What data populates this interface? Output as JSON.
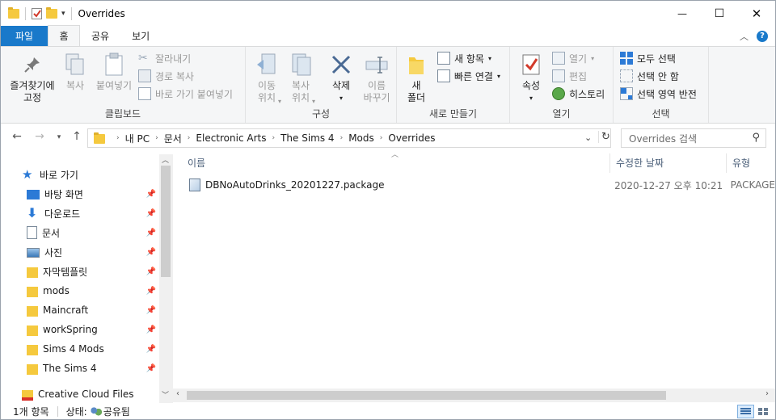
{
  "window": {
    "title": "Overrides",
    "minimize_glyph": "—",
    "maximize_glyph": "☐",
    "close_glyph": "✕"
  },
  "tabs": [
    {
      "label": "파일"
    },
    {
      "label": "홈"
    },
    {
      "label": "공유"
    },
    {
      "label": "보기"
    }
  ],
  "help_glyph": "?",
  "ribbon": {
    "clipboard": {
      "label": "클립보드",
      "pin": "즐겨찾기에\n고정",
      "copy": "복사",
      "paste": "붙여넣기",
      "cut": "잘라내기",
      "copy_path": "경로 복사",
      "paste_shortcut": "바로 가기 붙여넣기"
    },
    "organize": {
      "label": "구성",
      "move": "이동\n위치",
      "copy_to": "복사\n위치",
      "delete": "삭제",
      "rename": "이름\n바꾸기"
    },
    "new": {
      "label": "새로 만들기",
      "new_folder": "새\n폴더",
      "new_item": "새 항목",
      "easy_access": "빠른 연결"
    },
    "open": {
      "label": "열기",
      "properties": "속성",
      "open": "열기",
      "edit": "편집",
      "history": "히스토리"
    },
    "select": {
      "label": "선택",
      "select_all": "모두 선택",
      "select_none": "선택 안 함",
      "invert": "선택 영역 반전"
    }
  },
  "address": {
    "crumbs": [
      "내 PC",
      "문서",
      "Electronic Arts",
      "The Sims 4",
      "Mods",
      "Overrides"
    ],
    "search_placeholder": "Overrides 검색"
  },
  "sidebar": {
    "items": [
      {
        "label": "바로 가기",
        "icon": "star-icon"
      },
      {
        "label": "바탕 화면",
        "icon": "desktop-icon"
      },
      {
        "label": "다운로드",
        "icon": "download-icon"
      },
      {
        "label": "문서",
        "icon": "document-icon"
      },
      {
        "label": "사진",
        "icon": "pictures-icon"
      },
      {
        "label": "자막템플릿",
        "icon": "folder-icon"
      },
      {
        "label": "mods",
        "icon": "folder-icon"
      },
      {
        "label": "Maincraft",
        "icon": "folder-icon"
      },
      {
        "label": "workSpring",
        "icon": "folder-icon"
      },
      {
        "label": "Sims 4 Mods",
        "icon": "folder-icon"
      },
      {
        "label": "The Sims 4",
        "icon": "folder-icon"
      },
      {
        "label": "Creative Cloud Files",
        "icon": "creative-cloud-icon"
      }
    ]
  },
  "columns": {
    "name": "이름",
    "date": "수정한 날짜",
    "type": "유형"
  },
  "files": [
    {
      "name": "DBNoAutoDrinks_20201227.package",
      "date": "2020-12-27 오후 10:21",
      "type": "PACKAGE"
    }
  ],
  "status": {
    "count": "1개 항목",
    "state_label": "상태:",
    "state_value": "공유됨"
  }
}
